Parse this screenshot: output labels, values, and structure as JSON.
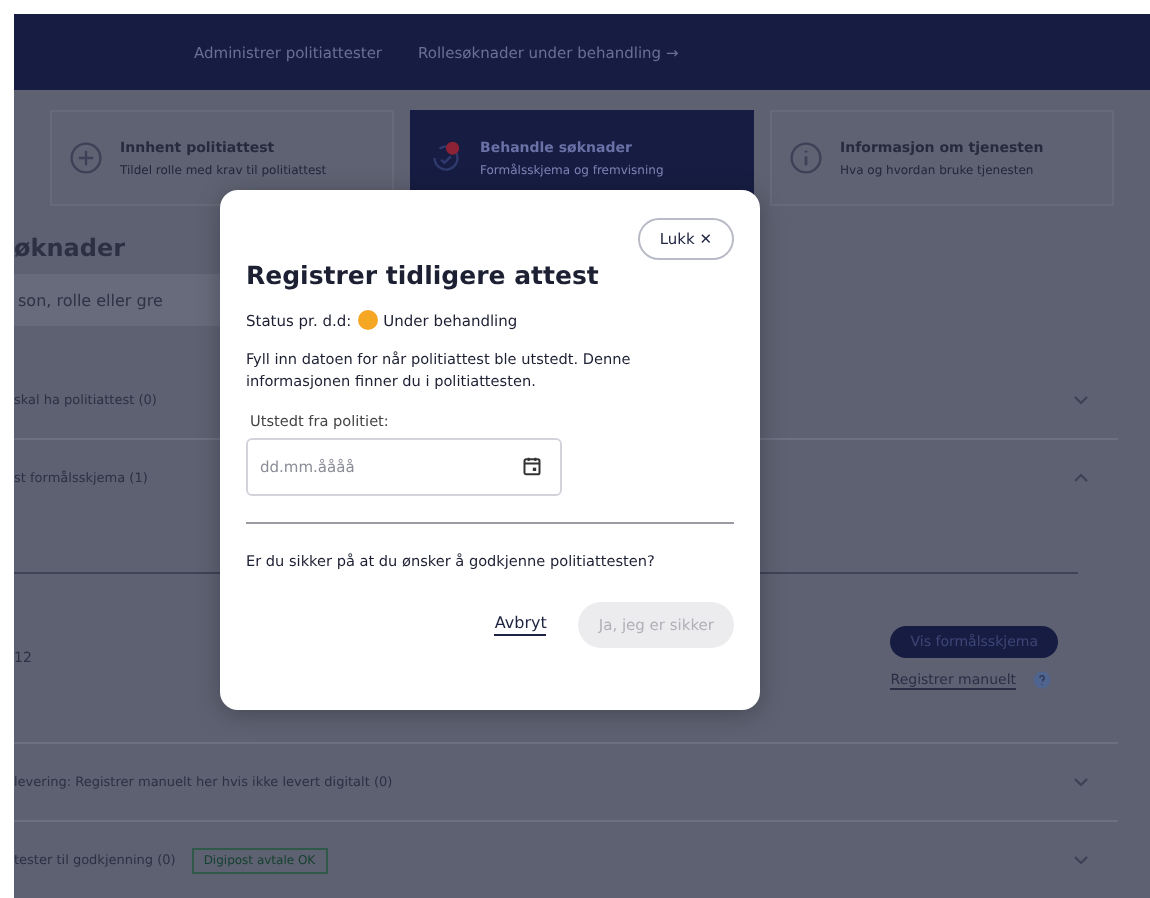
{
  "nav": {
    "links": [
      {
        "label": "Administrer politiattester"
      },
      {
        "label": "Rollesøknader under behandling →"
      }
    ]
  },
  "cards": [
    {
      "kind": "plus",
      "title": "Innhent politiattest",
      "subtitle": "Tildel rolle med krav til politiattest",
      "selected": false
    },
    {
      "kind": "refresh",
      "title": "Behandle søknader",
      "subtitle": "Formålsskjema og fremvisning",
      "selected": true
    },
    {
      "kind": "info",
      "title": "Informasjon om tjenesten",
      "subtitle": "Hva og hvordan bruke tjenesten",
      "selected": false
    }
  ],
  "page": {
    "heading": "øknader",
    "search": {
      "placeholder": "son, rolle eller gre"
    },
    "sections": [
      {
        "title": "skal ha politiattest (0)",
        "expanded": false
      },
      {
        "title": "st formålsskjema (1)",
        "expanded": true,
        "row": {
          "cell": "12",
          "button": "Vis formålsskjema",
          "link": "Registrer manuelt"
        }
      },
      {
        "title": "levering: Registrer manuelt her hvis ikke levert digitalt (0)",
        "expanded": false
      },
      {
        "title": "tester til godkjenning (0)",
        "tag": "Digipost avtale OK",
        "expanded": false
      }
    ]
  },
  "dialog": {
    "close": "Lukk ✕",
    "title": "Registrer tidligere attest",
    "status": {
      "label": "Status pr. d.d:",
      "value": "Under behandling",
      "color": "#f5a623"
    },
    "text": "Fyll inn datoen for når politiattest ble utstedt. Denne informasjonen finner du i politiattesten.",
    "field": {
      "label": "Utstedt fra politiet:",
      "placeholder": "dd.mm.åååå"
    },
    "question": "Er du sikker på at du ønsker å godkjenne politiattesten?",
    "cancel": "Avbryt",
    "confirm": {
      "label": "Ja, jeg er sikker",
      "disabled": true
    }
  }
}
